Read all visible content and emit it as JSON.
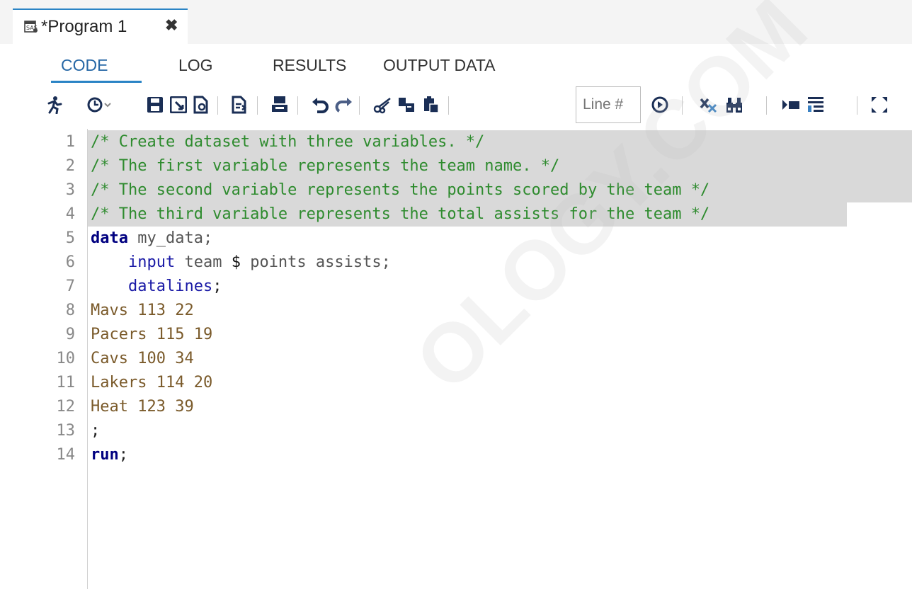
{
  "document_tab": {
    "title": "*Program 1",
    "close_symbol": "✖"
  },
  "sub_tabs": [
    "CODE",
    "LOG",
    "RESULTS",
    "OUTPUT DATA"
  ],
  "active_sub_tab": "CODE",
  "toolbar": {
    "line_placeholder": "Line #",
    "buttons": [
      "run-icon",
      "history-icon",
      "save-icon",
      "save-as-icon",
      "open-icon",
      "insert-icon",
      "print-icon",
      "undo-icon",
      "redo-icon",
      "cut-icon",
      "copy-icon",
      "paste-icon",
      "go-icon",
      "clear-icon",
      "find-icon",
      "indent-icon",
      "format-icon",
      "maximize-icon"
    ]
  },
  "editor": {
    "line_numbers": [
      "1",
      "2",
      "3",
      "4",
      "5",
      "6",
      "7",
      "8",
      "9",
      "10",
      "11",
      "12",
      "13",
      "14"
    ],
    "lines": [
      {
        "segments": [
          {
            "text": "/* Create dataset with three variables. */",
            "style": "comment"
          }
        ],
        "highlight": true
      },
      {
        "segments": [
          {
            "text": "/* The first variable represents the team name. */",
            "style": "comment"
          }
        ],
        "highlight": true
      },
      {
        "segments": [
          {
            "text": "/* The second variable represents the points scored by the team */",
            "style": "comment"
          }
        ],
        "highlight": true
      },
      {
        "segments": [
          {
            "text": "/* The third variable represents the total assists for the team */",
            "style": "comment"
          }
        ],
        "highlight": true
      },
      {
        "segments": [
          {
            "text": "data",
            "style": "kw"
          },
          {
            "text": " my_data;",
            "style": "plain"
          }
        ],
        "highlight": false
      },
      {
        "segments": [
          {
            "text": "    input",
            "style": "stmt"
          },
          {
            "text": " team ",
            "style": "plain"
          },
          {
            "text": "$",
            "style": "dollar"
          },
          {
            "text": " points assists;",
            "style": "plain"
          }
        ],
        "highlight": false
      },
      {
        "segments": [
          {
            "text": "    datalines",
            "style": "stmt"
          },
          {
            "text": ";",
            "style": "semi"
          }
        ],
        "highlight": false
      },
      {
        "segments": [
          {
            "text": "Mavs 113 22",
            "style": "data"
          }
        ],
        "highlight": false
      },
      {
        "segments": [
          {
            "text": "Pacers 115 19",
            "style": "data"
          }
        ],
        "highlight": false
      },
      {
        "segments": [
          {
            "text": "Cavs 100 34",
            "style": "data"
          }
        ],
        "highlight": false
      },
      {
        "segments": [
          {
            "text": "Lakers 114 20",
            "style": "data"
          }
        ],
        "highlight": false
      },
      {
        "segments": [
          {
            "text": "Heat 123 39",
            "style": "data"
          }
        ],
        "highlight": false
      },
      {
        "segments": [
          {
            "text": ";",
            "style": "semi"
          }
        ],
        "highlight": false
      },
      {
        "segments": [
          {
            "text": "run",
            "style": "kw"
          },
          {
            "text": ";",
            "style": "semi"
          }
        ],
        "highlight": false
      }
    ]
  },
  "watermark_text": "OLOGY.COM",
  "colors": {
    "accent": "#2a84c5",
    "comment": "#2e8b2e",
    "keyword": "#000080",
    "highlight": "#d9d9d9"
  }
}
